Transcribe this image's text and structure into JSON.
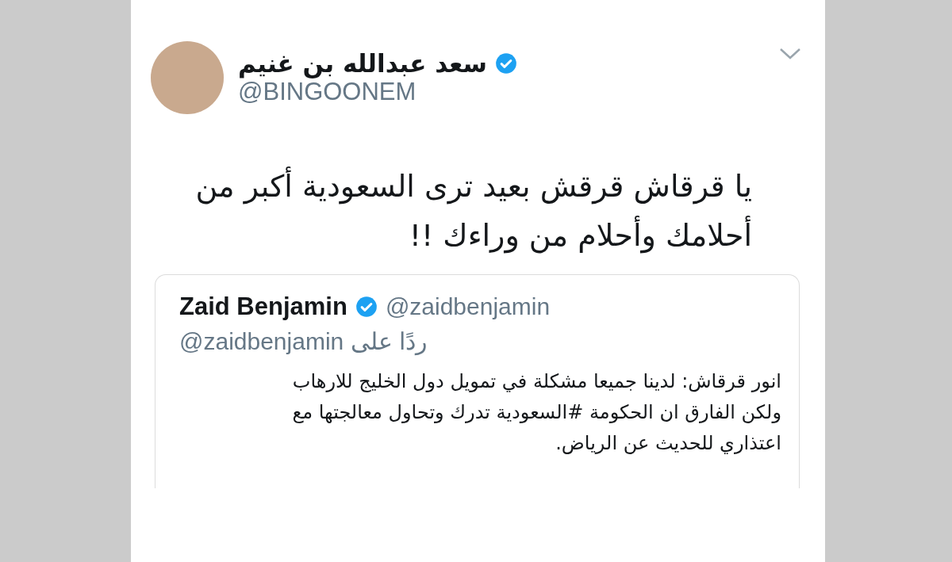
{
  "tweet": {
    "author_name": "سعد عبدالله بن غنيم",
    "verified": true,
    "handle": "@BINGOONEM",
    "text": "يا قرقاش قرقش بعيد ترى السعودية أكبر من\nأحلامك وأحلام من وراءك !!",
    "quoted_tweet": {
      "author_name": "Zaid Benjamin",
      "verified": true,
      "handle": "@zaidbenjamin",
      "reply_label": "ردًا على",
      "reply_handle": "@zaidbenjamin",
      "text": "انور قرقاش: لدينا جميعا مشكلة في تمويل دول الخليج للارهاب\nولكن الفارق ان الحكومة #السعودية تدرك وتحاول معالجتها مع\nاعتذاري للحديث عن الرياض."
    }
  }
}
